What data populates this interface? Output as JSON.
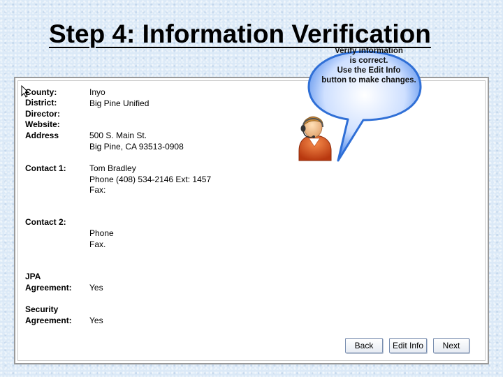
{
  "slide": {
    "title": "Step 4: Information Verification"
  },
  "fields": [
    {
      "id": "county",
      "label": "County:",
      "values": [
        "Inyo"
      ]
    },
    {
      "id": "district",
      "label": "District:",
      "values": [
        "Big Pine Unified"
      ]
    },
    {
      "id": "director",
      "label": "Director:",
      "values": []
    },
    {
      "id": "website",
      "label": "Website:",
      "values": []
    },
    {
      "id": "address",
      "label": "Address",
      "values": [
        "500 S. Main St.",
        "Big Pine, CA 93513-0908"
      ]
    },
    {
      "id": "contact1",
      "label": "Contact 1:",
      "values": [
        "Tom Bradley",
        "Phone  (408) 534-2146 Ext: 1457",
        "Fax:"
      ]
    },
    {
      "id": "contact2",
      "label": "Contact 2:",
      "values": [
        "",
        "Phone",
        "Fax."
      ]
    },
    {
      "id": "jpa",
      "label_lines": [
        "JPA",
        "Agreement:"
      ],
      "value": "Yes"
    },
    {
      "id": "security",
      "label_lines": [
        "Security",
        "Agreement:"
      ],
      "value": "Yes"
    }
  ],
  "tip": {
    "lines": [
      "Verify information",
      "is correct.",
      "Use  the Edit Info",
      "button to make changes."
    ]
  },
  "buttons": {
    "back": "Back",
    "edit": "Edit Info",
    "next": "Next"
  },
  "icons": {
    "cursor": "arrow-cursor-icon",
    "agent": "support-agent-icon"
  },
  "colors": {
    "bubble": "#2f6fd6",
    "agent_shirt": "#d9501c",
    "background": "#dbe9f7"
  }
}
